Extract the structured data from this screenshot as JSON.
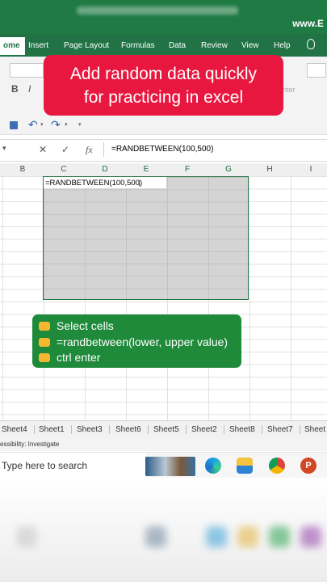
{
  "window": {
    "watermark": "www.E"
  },
  "ribbon_tabs": [
    "ome",
    "Insert",
    "Page Layout",
    "Formulas",
    "Data",
    "Review",
    "View",
    "Help"
  ],
  "ribbon": {
    "font_buttons": [
      "B",
      "I"
    ],
    "align_hint": "nter"
  },
  "formula_bar": {
    "cancel_symbol": "✕",
    "enter_symbol": "✓",
    "fx_symbol": "fx",
    "formula": "=RANDBETWEEN(100,500)"
  },
  "columns": [
    "B",
    "C",
    "D",
    "E",
    "F",
    "G",
    "H",
    "I"
  ],
  "selected_columns": [
    "C",
    "D",
    "E",
    "F",
    "G"
  ],
  "active_cell_text": "=RANDBETWEEN(100,500)",
  "banner": {
    "line1": "Add random data quickly",
    "line2": "for practicing in excel",
    "color": "#e8173f"
  },
  "steps": {
    "items": [
      "Select cells",
      "=randbetween(lower, upper value)",
      "ctrl enter"
    ],
    "color": "#1f8a3a"
  },
  "sheets": [
    "Sheet4",
    "Sheet1",
    "Sheet3",
    "Sheet6",
    "Sheet5",
    "Sheet2",
    "Sheet8",
    "Sheet7",
    "Sheet"
  ],
  "status": {
    "accessibility": "essibility: Investigate"
  },
  "taskbar": {
    "search_placeholder": "Type here to search",
    "icons": [
      "edge-icon",
      "file-explorer-icon",
      "chrome-icon",
      "powerpoint-icon"
    ]
  },
  "colors": {
    "excel_green": "#217346",
    "selection_border": "#217346"
  }
}
